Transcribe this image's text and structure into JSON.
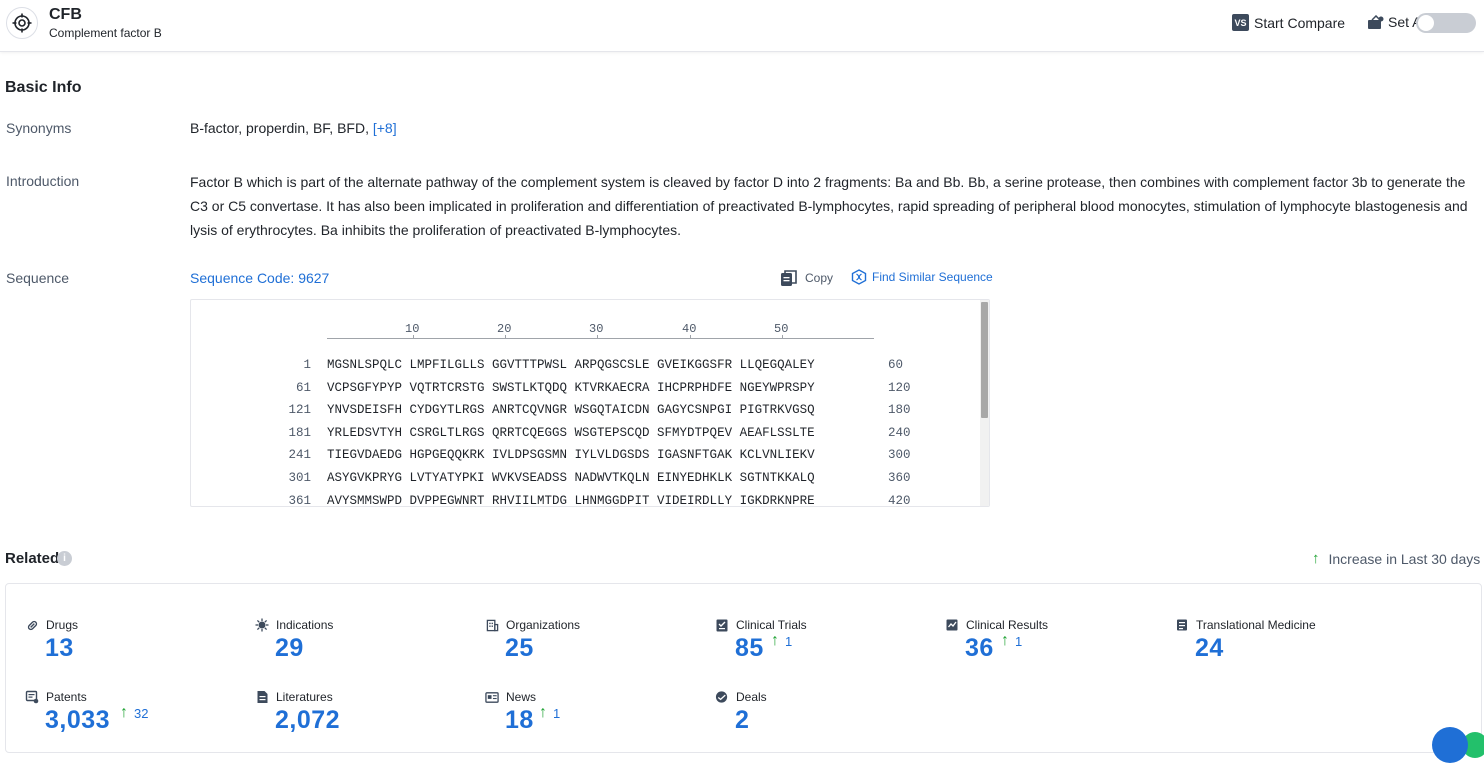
{
  "header": {
    "title": "CFB",
    "subtitle": "Complement factor B",
    "compare_icon": "VS",
    "compare_label": "Start Compare",
    "alert_label": "Set Alert",
    "alert_enabled": false
  },
  "basic_info": {
    "title": "Basic Info",
    "synonyms_label": "Synonyms",
    "synonyms_text": "B-factor, properdin,  BF,  BFD,",
    "synonyms_more": "[+8]",
    "introduction_label": "Introduction",
    "introduction": "Factor B which is part of the alternate pathway of the complement system is cleaved by factor D into 2 fragments: Ba and Bb. Bb, a serine protease, then combines with complement factor 3b to generate the C3 or C5 convertase. It has also been implicated in proliferation and differentiation of preactivated B-lymphocytes, rapid spreading of peripheral blood monocytes, stimulation of lymphocyte blastogenesis and lysis of erythrocytes. Ba inhibits the proliferation of preactivated B-lymphocytes.",
    "sequence_label": "Sequence",
    "sequence_code": "Sequence Code: 9627",
    "copy_label": "Copy",
    "find_similar_label": "Find Similar Sequence",
    "ruler": [
      "10",
      "20",
      "30",
      "40",
      "50"
    ],
    "sequence": [
      {
        "start": "1",
        "residues": "MGSNLSPQLC LMPFILGLLS GGVTTTPWSL ARPQGSCSLE GVEIKGGSFR LLQEGQALEY",
        "end": "60"
      },
      {
        "start": "61",
        "residues": "VCPSGFYPYP VQTRTCRSTG SWSTLKTQDQ KTVRKAECRA IHCPRPHDFE NGEYWPRSPY",
        "end": "120"
      },
      {
        "start": "121",
        "residues": "YNVSDEISFH CYDGYTLRGS ANRTCQVNGR WSGQTAICDN GAGYCSNPGI PIGTRKVGSQ",
        "end": "180"
      },
      {
        "start": "181",
        "residues": "YRLEDSVTYH CSRGLTLRGS QRRTCQEGGS WSGTEPSCQD SFMYDTPQEV AEAFLSSLTE",
        "end": "240"
      },
      {
        "start": "241",
        "residues": "TIEGVDAEDG HGPGEQQKRK IVLDPSGSMN IYLVLDGSDS IGASNFTGAK KCLVNLIEKV",
        "end": "300"
      },
      {
        "start": "301",
        "residues": "ASYGVKPRYG LVTYATYPKI WVKVSEADSS NADWVTKQLN EINYEDHKLK SGTNTKKALQ",
        "end": "360"
      },
      {
        "start": "361",
        "residues": "AVYSMMSWPD DVPPEGWNRT RHVIILMTDG LHNMGGDPIT VIDEIRDLLY IGKDRKNPRE",
        "end": "420"
      }
    ]
  },
  "related": {
    "title": "Related",
    "info_icon": "i",
    "legend_arrow": "↑",
    "legend": "Increase in Last 30 days",
    "stats": [
      {
        "icon": "pill-icon",
        "label": "Drugs",
        "value": "13",
        "increase": ""
      },
      {
        "icon": "virus-icon",
        "label": "Indications",
        "value": "29",
        "increase": ""
      },
      {
        "icon": "building-icon",
        "label": "Organizations",
        "value": "25",
        "increase": ""
      },
      {
        "icon": "clipboard-icon",
        "label": "Clinical Trials",
        "value": "85",
        "increase": "1"
      },
      {
        "icon": "chart-doc-icon",
        "label": "Clinical Results",
        "value": "36",
        "increase": "1"
      },
      {
        "icon": "book-icon",
        "label": "Translational Medicine",
        "value": "24",
        "increase": ""
      },
      {
        "icon": "patent-icon",
        "label": "Patents",
        "value": "3,033",
        "increase": "32"
      },
      {
        "icon": "document-icon",
        "label": "Literatures",
        "value": "2,072",
        "increase": ""
      },
      {
        "icon": "news-icon",
        "label": "News",
        "value": "18",
        "increase": "1"
      },
      {
        "icon": "handshake-icon",
        "label": "Deals",
        "value": "2",
        "increase": ""
      }
    ]
  },
  "colors": {
    "accent": "#1f6fd6",
    "increase": "#23a437",
    "label": "#4e5969"
  }
}
